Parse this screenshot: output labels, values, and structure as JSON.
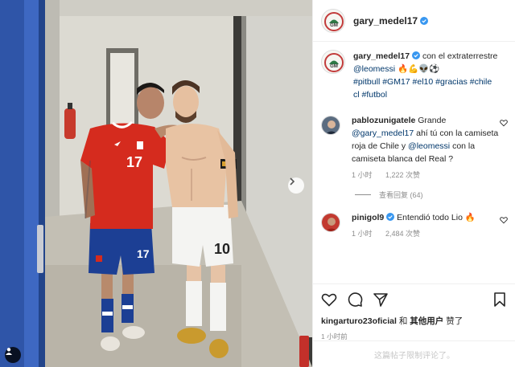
{
  "post": {
    "author": "gary_medel17",
    "caption_text": "con el extraterrestre",
    "caption_mention": "@leomessi",
    "caption_emoji": "🔥💪👽⚽",
    "caption_tags": "#pitbull #GM17 #el10 #gracias #chile",
    "caption_tags2": "cl #futbol"
  },
  "comments": [
    {
      "user": "pablozunigatele",
      "text_1": "Grande",
      "mention_1": "@gary_medel17",
      "text_2": "ahí tú con la camiseta roja de Chile y",
      "mention_2": "@leomessi",
      "text_3": "con la camiseta blanca del Real ?",
      "time": "1 小时",
      "likes": "1,222 次赞",
      "replies": "查看回复 (64)"
    },
    {
      "user": "pinigol9",
      "text_1": "Entendió todo Lio",
      "emoji": "🔥",
      "time": "1 小时",
      "likes": "2,484 次赞"
    }
  ],
  "likes_line": {
    "user": "kingarturo23oficial",
    "connector": "和",
    "others": "其他用户",
    "suffix": "赞了"
  },
  "post_time": "1 小时前",
  "comments_closed": "这篇帖子限制评论了。",
  "colors": {
    "verified": "#3897f0",
    "mention": "#00376b",
    "chile_red": "#d52b1e",
    "chile_blue": "#1c3f94"
  }
}
